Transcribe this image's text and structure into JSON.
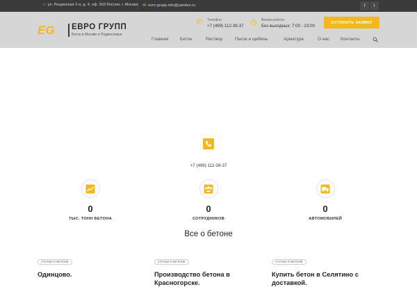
{
  "topbar": {
    "address": "ул. Рощинская 2-я, д. 4, оф. 503 Россия, г. Москва",
    "email": "evro-grupp.info@yandex.ru",
    "address_icon": "home-icon",
    "email_icon": "envelope-icon",
    "social": [
      {
        "icon": "facebook-icon",
        "glyph": "f"
      },
      {
        "icon": "twitter-icon",
        "glyph": "t"
      }
    ]
  },
  "logo": {
    "mark": "EG",
    "name": "ЕВРО ГРУПП",
    "tagline": "Бетон в Москве и Подмосковье"
  },
  "contacts": {
    "phone_label": "Телефон",
    "phone_value": "+7 (499) 112-39-37",
    "hours_label": "Время работы",
    "hours_value": "Без выходных: 7:00 - 23:00"
  },
  "cta_label": "Оставить заявку",
  "nav": {
    "items": [
      "Главная",
      "Бетон",
      "Раствор",
      "Песок и щебень",
      "Арматура",
      "О нас",
      "Контакты"
    ]
  },
  "phone_block": {
    "number": "+7 (499) 112-39-37"
  },
  "stats": [
    {
      "value": "0",
      "label": "ТЫС. ТОНН БЕТОНА",
      "icon": "chart-icon"
    },
    {
      "value": "0",
      "label": "СОТРУДНИКОВ",
      "icon": "team-icon"
    },
    {
      "value": "0",
      "label": "АВТОМОБИЛЕЙ",
      "icon": "truck-icon"
    }
  ],
  "section_title": "Все о бетоне",
  "articles": [
    {
      "tag": "Статьи о бетоне",
      "title": "Одинцово."
    },
    {
      "tag": "Статьи о бетоне",
      "title": "Производство бетона в Красногорске."
    },
    {
      "tag": "Статьи о бетоне",
      "title": "Купить бетон в Селятино с доставкой."
    }
  ],
  "colors": {
    "accent": "#f5b81c",
    "topbar": "#3a3a3a",
    "header": "#d6d6d6"
  }
}
